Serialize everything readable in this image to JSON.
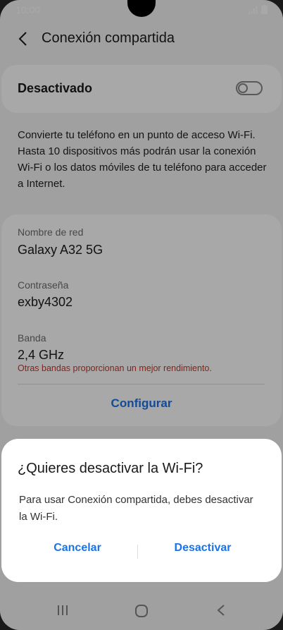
{
  "status_bar": {
    "time": "10:00"
  },
  "header": {
    "title": "Conexión compartida"
  },
  "toggle": {
    "label": "Desactivado",
    "state": "off"
  },
  "description": "Convierte tu teléfono en un punto de acceso Wi-Fi. Hasta 10 dispositivos más podrán usar la conexión Wi-Fi o los datos móviles de tu teléfono para acceder a Internet.",
  "network": {
    "name_label": "Nombre de red",
    "name_value": "Galaxy A32 5G",
    "password_label": "Contraseña",
    "password_value": "exby4302",
    "band_label": "Banda",
    "band_value": "2,4 GHz",
    "band_note": "Otras bandas proporcionan un mejor rendimiento.",
    "configure": "Configurar"
  },
  "dialog": {
    "title": "¿Quieres desactivar la Wi-Fi?",
    "message": "Para usar Conexión compartida, debes desactivar la Wi-Fi.",
    "cancel": "Cancelar",
    "confirm": "Desactivar"
  },
  "colors": {
    "accent": "#1a73e8",
    "warning": "#c0392b"
  },
  "icons": [
    "back-arrow-icon",
    "signal-icon",
    "battery-icon",
    "recent-apps-icon",
    "home-icon",
    "nav-back-icon"
  ]
}
